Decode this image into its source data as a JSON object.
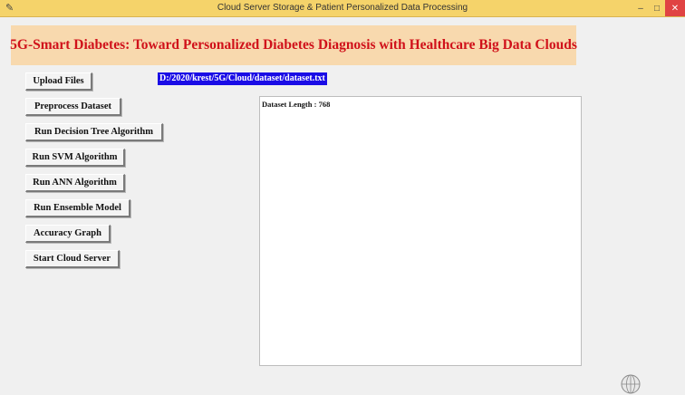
{
  "window": {
    "title": "Cloud Server Storage & Patient Personalized Data Processing",
    "controls": {
      "minimize": "–",
      "maximize": "□",
      "close": "✕"
    }
  },
  "header": {
    "title": "5G-Smart Diabetes: Toward Personalized Diabetes Diagnosis with Healthcare Big Data Clouds"
  },
  "buttons": {
    "upload_files": "Upload Files",
    "preprocess_dataset": "Preprocess Dataset",
    "run_decision_tree": "Run Decision Tree Algorithm",
    "run_svm": "Run SVM Algorithm",
    "run_ann": "Run ANN Algorithm",
    "run_ensemble": "Run Ensemble Model",
    "accuracy_graph": "Accuracy Graph",
    "start_cloud_server": "Start Cloud Server"
  },
  "file_path": "D:/2020/krest/5G/Cloud/dataset/dataset.txt",
  "output": {
    "text": "Dataset Length : 768"
  },
  "colors": {
    "titlebar": "#f5d36a",
    "banner_bg": "#f8d9ae",
    "banner_text": "#d0111a",
    "path_bg": "#1a0ce6",
    "close_button": "#e04343"
  },
  "icons": {
    "app": "feather-icon",
    "taskbar": "globe-icon"
  }
}
